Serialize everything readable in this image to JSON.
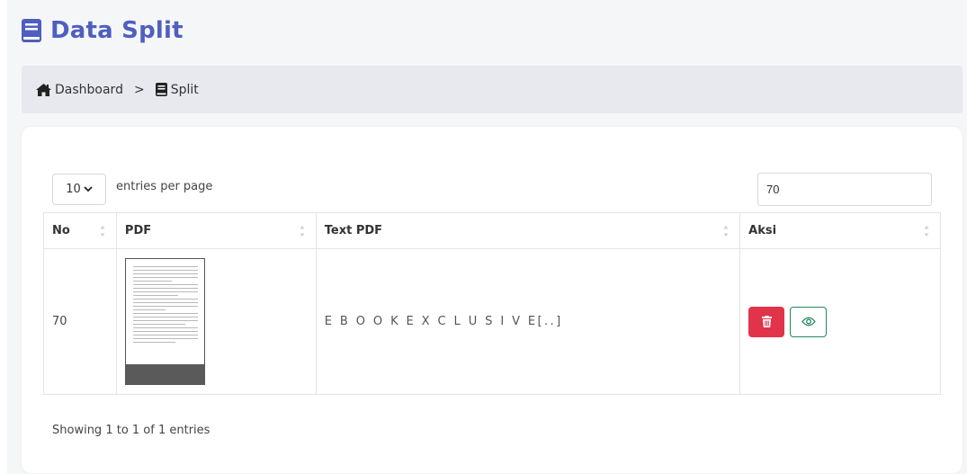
{
  "page": {
    "title": "Data Split",
    "title_color": "#4e5fc0",
    "title_icon": "book-icon"
  },
  "breadcrumb": {
    "items": [
      {
        "label": "Dashboard",
        "icon": "home-icon"
      },
      {
        "label": "Split",
        "icon": "book-icon"
      }
    ],
    "separator": ">"
  },
  "table_controls": {
    "per_page_value": "10",
    "per_page_label": "entries per page",
    "search_value": "70"
  },
  "table": {
    "columns": [
      "No",
      "PDF",
      "Text PDF",
      "Aksi"
    ],
    "rows": [
      {
        "no": "70",
        "pdf_thumbnail": "pdf-page-thumbnail",
        "text_pdf": "E B O O K E X C L U S I V E[..]",
        "actions": [
          "delete",
          "view"
        ]
      }
    ]
  },
  "footer": {
    "info": "Showing 1 to 1 of 1 entries"
  },
  "colors": {
    "delete_button": "#e1334a",
    "view_button_border": "#1f8a5d",
    "breadcrumb_bg": "#e7e9ee"
  }
}
